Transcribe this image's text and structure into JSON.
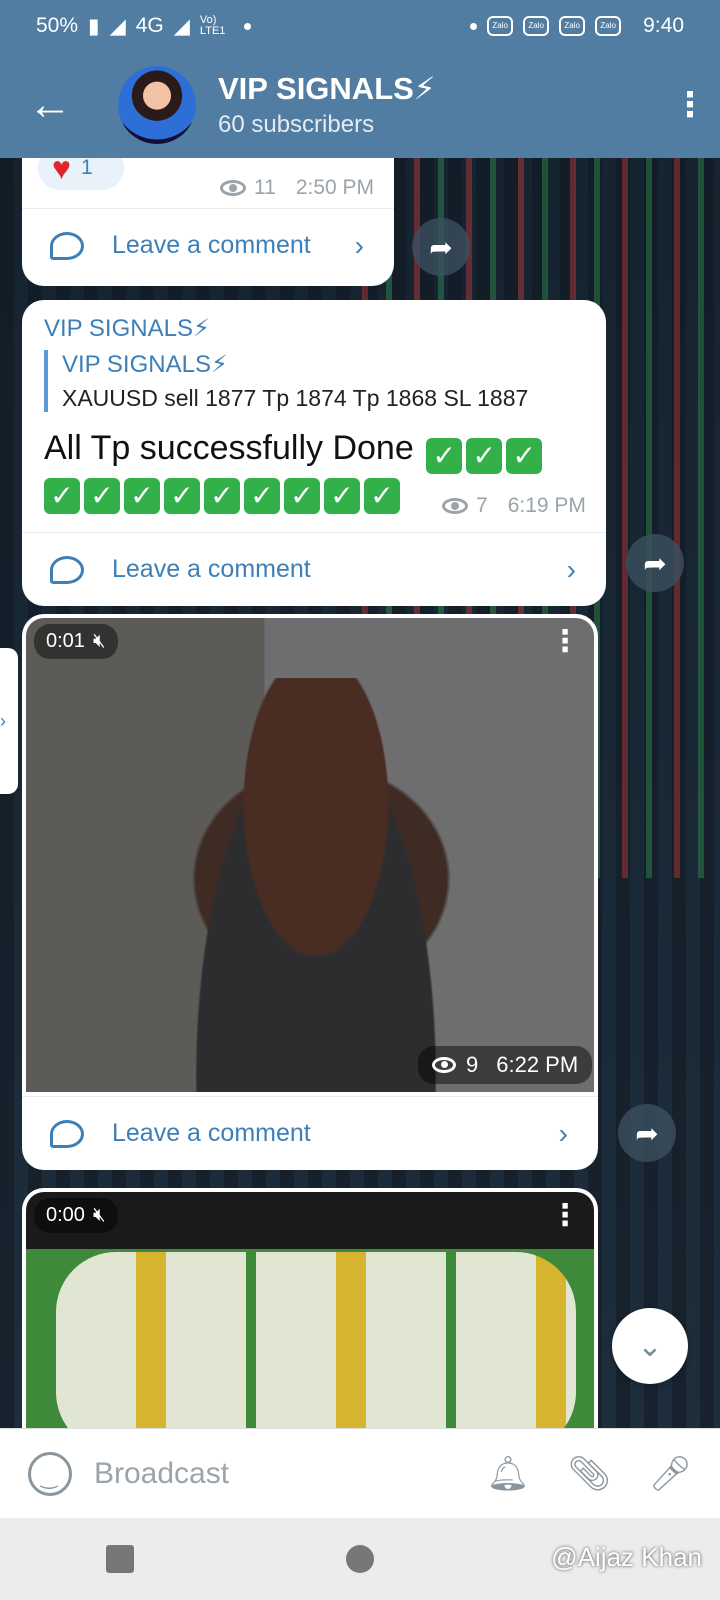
{
  "status": {
    "battery": "50%",
    "network": "4G",
    "volte": "Vo) LTE1",
    "zalo": [
      "Zalo",
      "Zalo",
      "Zalo",
      "Zalo"
    ],
    "time": "9:40"
  },
  "header": {
    "title": "VIP SIGNALS⚡",
    "subtitle": "60 subscribers"
  },
  "messages": [
    {
      "reaction_count": "1",
      "views": "11",
      "time": "2:50 PM",
      "comment_label": "Leave a comment"
    },
    {
      "sender": "VIP SIGNALS⚡",
      "quote_sender": "VIP SIGNALS⚡",
      "quote_text": "XAUUSD sell 1877 Tp 1874 Tp 1868  SL 1887",
      "text": "All Tp successfully Done",
      "views": "7",
      "time": "6:19 PM",
      "comment_label": "Leave a comment"
    },
    {
      "duration": "0:01",
      "views": "9",
      "time": "6:22 PM",
      "comment_label": "Leave a comment"
    },
    {
      "duration": "0:00"
    }
  ],
  "input": {
    "placeholder": "Broadcast"
  },
  "watermark": "@Aijaz Khan",
  "colors": {
    "header": "#517da2",
    "link": "#3d7fb8",
    "check": "#33b04a"
  }
}
